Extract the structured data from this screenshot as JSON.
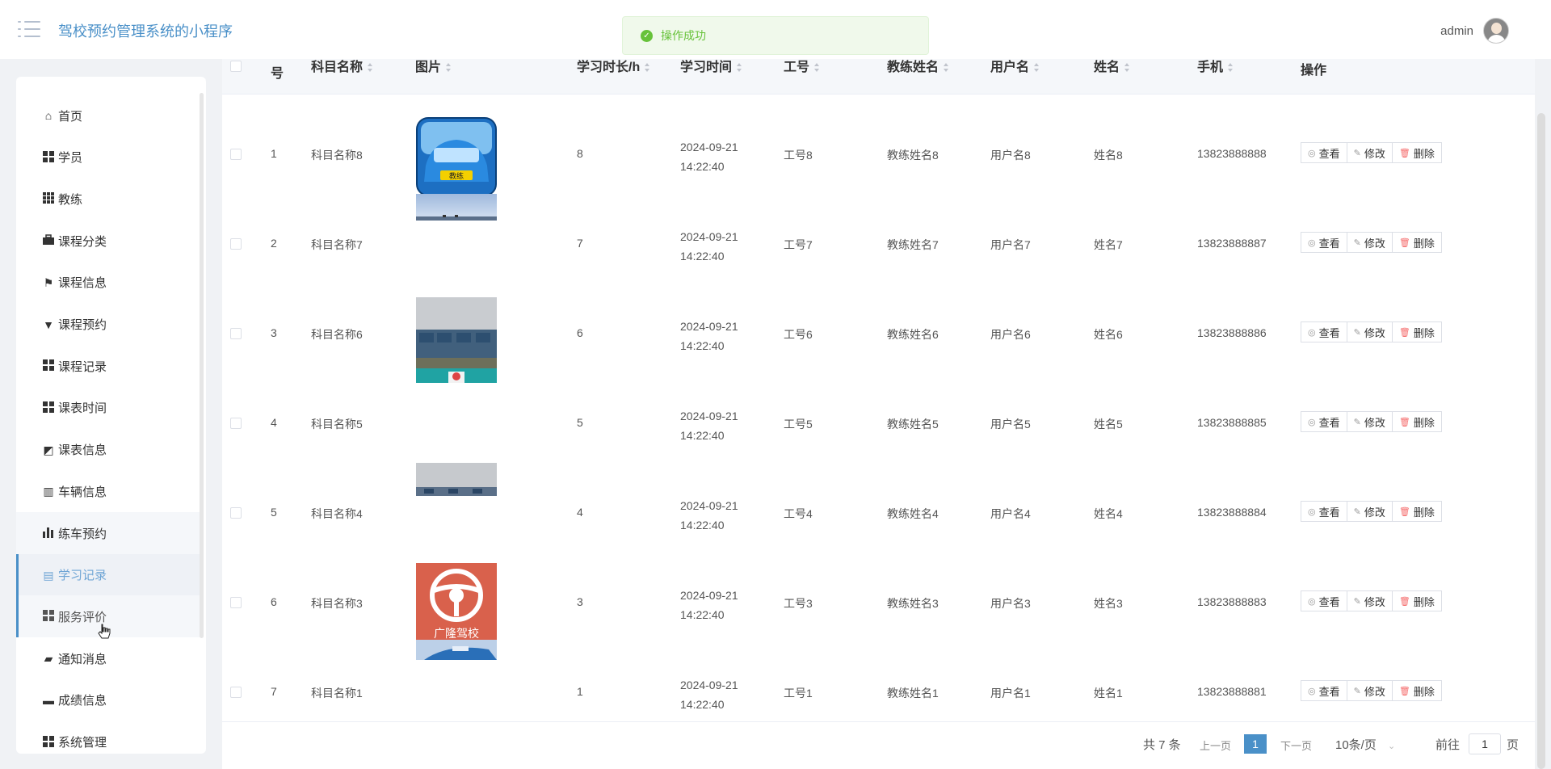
{
  "header": {
    "app_title": "驾校预约管理系统的小程序",
    "user_name": "admin",
    "menu_icon": "list-icon"
  },
  "toast": {
    "text": "操作成功",
    "icon": "check-circle-icon",
    "color": "#67c23a"
  },
  "sidebar": {
    "items": [
      {
        "label": "首页",
        "icon": "home-icon"
      },
      {
        "label": "学员",
        "icon": "grid-icon"
      },
      {
        "label": "教练",
        "icon": "grid-9-icon"
      },
      {
        "label": "课程分类",
        "icon": "briefcase-icon"
      },
      {
        "label": "课程信息",
        "icon": "flag-icon"
      },
      {
        "label": "课程预约",
        "icon": "stamp-icon"
      },
      {
        "label": "课程记录",
        "icon": "grid-icon"
      },
      {
        "label": "课表时间",
        "icon": "grid-icon"
      },
      {
        "label": "课表信息",
        "icon": "chart-icon"
      },
      {
        "label": "车辆信息",
        "icon": "books-icon"
      },
      {
        "label": "练车预约",
        "icon": "bar-chart-icon"
      },
      {
        "label": "学习记录",
        "icon": "clipboard-icon"
      },
      {
        "label": "服务评价",
        "icon": "grid-icon"
      },
      {
        "label": "通知消息",
        "icon": "ticket-icon"
      },
      {
        "label": "成绩信息",
        "icon": "inbox-icon"
      },
      {
        "label": "系统管理",
        "icon": "grid-icon"
      }
    ],
    "active_index": 11
  },
  "table": {
    "columns": [
      "序号",
      "科目名称",
      "图片",
      "学习时长/h",
      "学习时间",
      "工号",
      "教练姓名",
      "用户名",
      "姓名",
      "手机",
      "操作"
    ],
    "column_display": [
      "号",
      "科目名称",
      "图片",
      "学习时长/h",
      "学习时间",
      "工号",
      "教练姓名",
      "用户名",
      "姓名",
      "手机",
      "操作"
    ],
    "rows": [
      {
        "no": "1",
        "subject": "科目名称8",
        "hours": "8",
        "time": "2024-09-21 14:22:40",
        "job_no": "工号8",
        "coach": "教练姓名8",
        "username": "用户名8",
        "name": "姓名8",
        "phone": "13823888888",
        "image": "blue-car",
        "image_text": "教练"
      },
      {
        "no": "2",
        "subject": "科目名称7",
        "hours": "7",
        "time": "2024-09-21 14:22:40",
        "job_no": "工号7",
        "coach": "教练姓名7",
        "username": "用户名7",
        "name": "姓名7",
        "phone": "13823888887",
        "image": "sky-strip"
      },
      {
        "no": "3",
        "subject": "科目名称6",
        "hours": "6",
        "time": "2024-09-21 14:22:40",
        "job_no": "工号6",
        "coach": "教练姓名6",
        "username": "用户名6",
        "name": "姓名6",
        "phone": "13823888886",
        "image": "car-lot"
      },
      {
        "no": "4",
        "subject": "科目名称5",
        "hours": "5",
        "time": "2024-09-21 14:22:40",
        "job_no": "工号5",
        "coach": "教练姓名5",
        "username": "用户名5",
        "name": "姓名5",
        "phone": "13823888885",
        "image": "teal-strip"
      },
      {
        "no": "5",
        "subject": "科目名称4",
        "hours": "4",
        "time": "2024-09-21 14:22:40",
        "job_no": "工号4",
        "coach": "教练姓名4",
        "username": "用户名4",
        "name": "姓名4",
        "phone": "13823888884",
        "image": "lot-strip"
      },
      {
        "no": "6",
        "subject": "科目名称3",
        "hours": "3",
        "time": "2024-09-21 14:22:40",
        "job_no": "工号3",
        "coach": "教练姓名3",
        "username": "用户名3",
        "name": "姓名3",
        "phone": "13823888883",
        "image": "logo-red",
        "image_text": "广隆驾校"
      },
      {
        "no": "7",
        "subject": "科目名称1",
        "hours": "1",
        "time": "2024-09-21 14:22:40",
        "job_no": "工号1",
        "coach": "教练姓名1",
        "username": "用户名1",
        "name": "姓名1",
        "phone": "13823888881",
        "image": "blue-strip"
      }
    ],
    "actions": {
      "view": "查看",
      "edit": "修改",
      "delete": "删除"
    }
  },
  "pagination": {
    "total": "共 7 条",
    "prev": "上一页",
    "page": "1",
    "next": "下一页",
    "size": "10条/页",
    "goto": "前往",
    "goto_value": "1",
    "page_unit": "页"
  },
  "colors": {
    "accent": "#4a90c8",
    "success": "#67c23a",
    "danger": "#f56c6c"
  }
}
